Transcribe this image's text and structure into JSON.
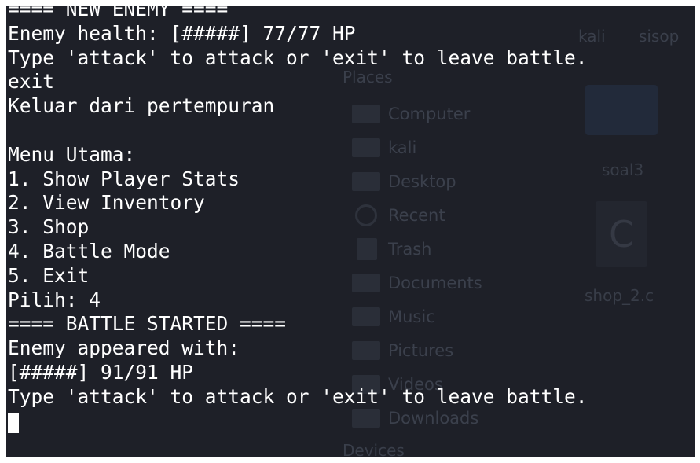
{
  "terminal": {
    "lines": [
      "==== NEW ENEMY ====",
      "Enemy health: [#####] 77/77 HP",
      "Type 'attack' to attack or 'exit' to leave battle.",
      "exit",
      "Keluar dari pertempuran",
      "",
      "Menu Utama:",
      "1. Show Player Stats",
      "2. View Inventory",
      "3. Shop",
      "4. Battle Mode",
      "5. Exit",
      "Pilih: 4",
      "==== BATTLE STARTED ====",
      "Enemy appeared with:",
      "[#####] 91/91 HP",
      "Type 'attack' to attack or 'exit' to leave battle."
    ],
    "colors": {
      "background": "#1e2028",
      "text": "#ffffff",
      "cursor": "#ffffff"
    }
  },
  "file_manager_background": {
    "pathbar": [
      "kali",
      "sisop"
    ],
    "places_title": "Places",
    "places": [
      {
        "label": "Computer",
        "icon": "computer-icon"
      },
      {
        "label": "kali",
        "icon": "home-folder-icon"
      },
      {
        "label": "Desktop",
        "icon": "desktop-icon"
      },
      {
        "label": "Recent",
        "icon": "clock-icon"
      },
      {
        "label": "Trash",
        "icon": "trash-icon"
      },
      {
        "label": "Documents",
        "icon": "documents-icon"
      },
      {
        "label": "Music",
        "icon": "music-icon"
      },
      {
        "label": "Pictures",
        "icon": "pictures-icon"
      },
      {
        "label": "Videos",
        "icon": "videos-icon"
      },
      {
        "label": "Downloads",
        "icon": "downloads-icon"
      }
    ],
    "devices_title": "Devices",
    "files": [
      {
        "label": "soal3",
        "icon": "folder-icon"
      },
      {
        "label": "shop_2.c",
        "icon": "c-source-file-icon",
        "glyph": "C"
      }
    ]
  }
}
